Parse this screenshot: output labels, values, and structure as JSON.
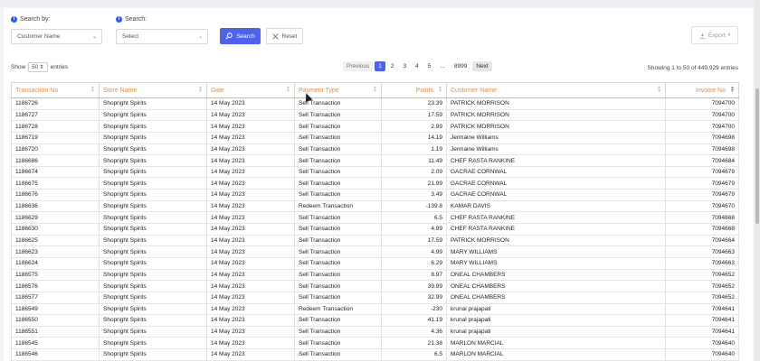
{
  "search_by": {
    "label": "Search by:",
    "value": "Customer Name"
  },
  "search": {
    "label": "Search:",
    "value": "Select"
  },
  "buttons": {
    "search": "Search",
    "reset": "Reset",
    "export": "Export"
  },
  "show": {
    "prefix": "Show",
    "value": "50",
    "suffix": "entries"
  },
  "pagination": {
    "previous": "Previous",
    "pages": [
      "1",
      "2",
      "3",
      "4",
      "5"
    ],
    "ellipsis": "...",
    "last": "8999",
    "next": "Next"
  },
  "summary": "Showing 1 to 50 of 449,929 entries",
  "table": {
    "headers": [
      "Transaction No",
      "Store Name",
      "Date",
      "Payment Type",
      "Points",
      "Customer Name",
      "Invoice No"
    ],
    "rows": [
      [
        "1186726",
        "Shopright Spirits",
        "14 May 2023",
        "Sell Transaction",
        "23.39",
        "PATRICK MORRISON",
        "7094700"
      ],
      [
        "1186727",
        "Shopright Spirits",
        "14 May 2023",
        "Sell Transaction",
        "17.59",
        "PATRICK MORRISON",
        "7094700"
      ],
      [
        "1186728",
        "Shopright Spirits",
        "14 May 2023",
        "Sell Transaction",
        "2.99",
        "PATRICK MORRISON",
        "7094700"
      ],
      [
        "1186719",
        "Shopright Spirits",
        "14 May 2023",
        "Sell Transaction",
        "14.19",
        "Jermaine Williams",
        "7094698"
      ],
      [
        "1186720",
        "Shopright Spirits",
        "14 May 2023",
        "Sell Transaction",
        "1.19",
        "Jermaine Williams",
        "7094698"
      ],
      [
        "1186686",
        "Shopright Spirits",
        "14 May 2023",
        "Sell Transaction",
        "11.49",
        "CHEF RASTA RANKINE",
        "7094684"
      ],
      [
        "1186674",
        "Shopright Spirits",
        "14 May 2023",
        "Sell Transaction",
        "2.09",
        "GACRAE CORNWAL",
        "7094679"
      ],
      [
        "1186675",
        "Shopright Spirits",
        "14 May 2023",
        "Sell Transaction",
        "21.99",
        "GACRAE CORNWAL",
        "7094679"
      ],
      [
        "1186676",
        "Shopright Spirits",
        "14 May 2023",
        "Sell Transaction",
        "3.49",
        "GACRAE CORNWAL",
        "7094679"
      ],
      [
        "1186636",
        "Shopright Spirits",
        "14 May 2023",
        "Redeem Transaction",
        "-139.8",
        "KAMAR DAVIS",
        "7094670"
      ],
      [
        "1186629",
        "Shopright Spirits",
        "14 May 2023",
        "Sell Transaction",
        "6.5",
        "CHEF RASTA RANKINE",
        "7094668"
      ],
      [
        "1186630",
        "Shopright Spirits",
        "14 May 2023",
        "Sell Transaction",
        "4.99",
        "CHEF RASTA RANKINE",
        "7094668"
      ],
      [
        "1186625",
        "Shopright Spirits",
        "14 May 2023",
        "Sell Transaction",
        "17.59",
        "PATRICK MORRISON",
        "7094664"
      ],
      [
        "1186623",
        "Shopright Spirits",
        "14 May 2023",
        "Sell Transaction",
        "4.99",
        "MARY WILLIAMS",
        "7094663"
      ],
      [
        "1186624",
        "Shopright Spirits",
        "14 May 2023",
        "Sell Transaction",
        "6.29",
        "MARY WILLIAMS",
        "7094663"
      ],
      [
        "1186575",
        "Shopright Spirits",
        "14 May 2023",
        "Sell Transaction",
        "8.97",
        "ONEAL CHAMBERS",
        "7094652"
      ],
      [
        "1186576",
        "Shopright Spirits",
        "14 May 2023",
        "Sell Transaction",
        "39.99",
        "ONEAL CHAMBERS",
        "7094652"
      ],
      [
        "1186577",
        "Shopright Spirits",
        "14 May 2023",
        "Sell Transaction",
        "32.99",
        "ONEAL CHAMBERS",
        "7094652"
      ],
      [
        "1186549",
        "Shopright Spirits",
        "14 May 2023",
        "Redeem Transaction",
        "-230",
        "krunal prajapati",
        "7094641"
      ],
      [
        "1186550",
        "Shopright Spirits",
        "14 May 2023",
        "Sell Transaction",
        "41.19",
        "krunal prajapati",
        "7094641"
      ],
      [
        "1186551",
        "Shopright Spirits",
        "14 May 2023",
        "Sell Transaction",
        "4.36",
        "krunal prajapati",
        "7094641"
      ],
      [
        "1186545",
        "Shopright Spirits",
        "14 May 2023",
        "Sell Transaction",
        "21.38",
        "MARLON MARCIAL",
        "7094640"
      ],
      [
        "1186546",
        "Shopright Spirits",
        "14 May 2023",
        "Sell Transaction",
        "6.5",
        "MARLON MARCIAL",
        "7094640"
      ]
    ]
  }
}
